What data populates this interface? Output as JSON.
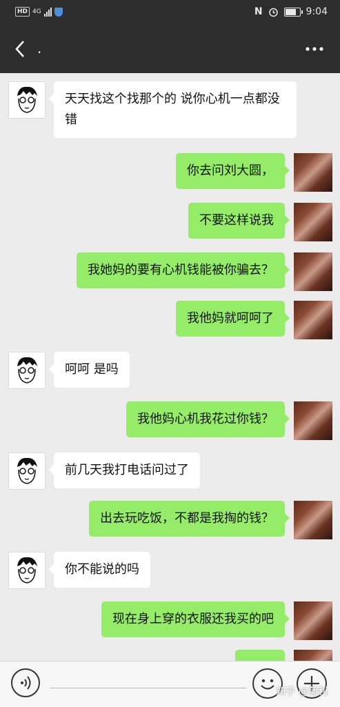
{
  "status_bar": {
    "hd_badge": "HD",
    "network": "4G",
    "nfc_label": "N",
    "time": "9:04"
  },
  "header": {
    "title": ".",
    "back_icon": "chevron-left-icon",
    "more_icon": "more-dots-icon"
  },
  "messages": [
    {
      "side": "in",
      "text": "天天找这个找那个的 说你心机一点都没错"
    },
    {
      "side": "out",
      "text": "你去问刘大圆，"
    },
    {
      "side": "out",
      "text": "不要这样说我"
    },
    {
      "side": "out",
      "text": "我她妈的要有心机钱能被你骗去？"
    },
    {
      "side": "out",
      "text": "我他妈就呵呵了"
    },
    {
      "side": "in",
      "text": "呵呵 是吗"
    },
    {
      "side": "out",
      "text": "我他妈心机我花过你钱？"
    },
    {
      "side": "in",
      "text": "前几天我打电话问过了"
    },
    {
      "side": "out",
      "text": "出去玩吃饭，不都是我掏的钱？"
    },
    {
      "side": "in",
      "text": "你不能说的吗"
    },
    {
      "side": "out",
      "text": "现在身上穿的衣服还我买的吧"
    }
  ],
  "input_bar": {
    "voice_icon": "voice-icon",
    "emoji_icon": "emoji-icon",
    "plus_icon": "plus-icon"
  },
  "watermark": "知乎 @蒲利",
  "colors": {
    "bar_bg": "#2d2d2d",
    "chat_bg": "#ececec",
    "outgoing_bubble": "#95ec69",
    "incoming_bubble": "#ffffff"
  }
}
